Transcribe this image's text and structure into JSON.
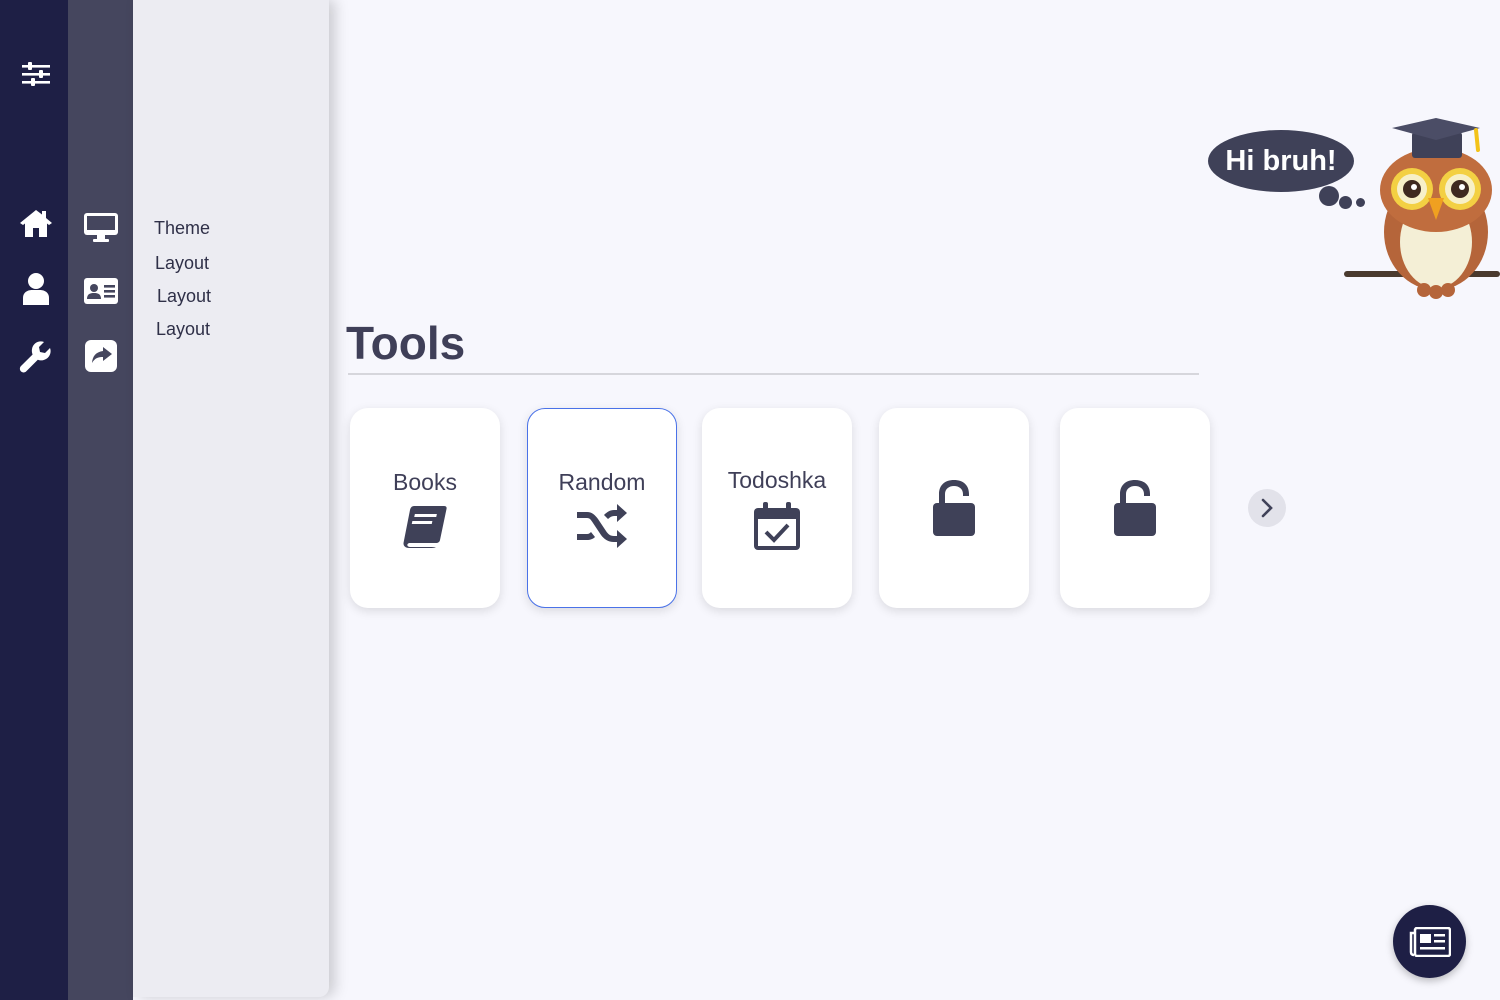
{
  "rail": {
    "icons": [
      "sliders-icon",
      "home-icon",
      "user-icon",
      "wrench-icon"
    ]
  },
  "rail2": {
    "icons": [
      "monitor-icon",
      "id-card-icon",
      "share-icon"
    ]
  },
  "panel": {
    "items": [
      {
        "label": "Theme"
      },
      {
        "label": "Layout"
      },
      {
        "label": "Layout"
      },
      {
        "label": "Layout"
      }
    ]
  },
  "mascot": {
    "speech": "Hi bruh!"
  },
  "tools": {
    "title": "Tools",
    "cards": [
      {
        "label": "Books",
        "icon": "book-icon",
        "selected": false
      },
      {
        "label": "Random",
        "icon": "shuffle-icon",
        "selected": true
      },
      {
        "label": "Todoshka",
        "icon": "calendar-check-icon",
        "selected": false
      },
      {
        "label": "",
        "icon": "unlock-icon",
        "selected": false
      },
      {
        "label": "",
        "icon": "unlock-icon",
        "selected": false
      }
    ]
  },
  "colors": {
    "rail": "#1e1f45",
    "rail2": "#45465e",
    "panel": "#ececf2",
    "background": "#f7f7fd",
    "accent": "#4a72e8",
    "text": "#3f3f58"
  }
}
